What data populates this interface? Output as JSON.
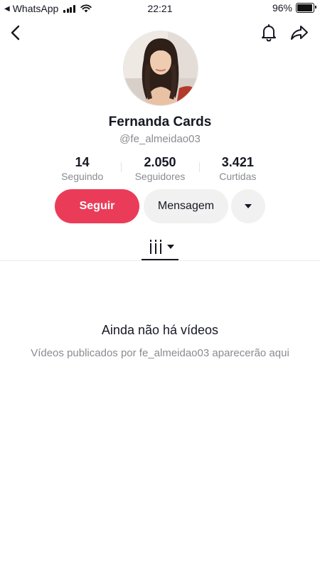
{
  "status_bar": {
    "back_app": "WhatsApp",
    "time": "22:21",
    "battery": "96%",
    "battery_level": 0.96
  },
  "header": {
    "back_icon": "chevron-left-icon",
    "bell_icon": "bell-icon",
    "share_icon": "share-arrow-icon"
  },
  "profile": {
    "name": "Fernanda Cards",
    "handle": "@fe_almeidao03",
    "avatar": "profile-photo"
  },
  "stats": [
    {
      "value": "14",
      "label": "Seguindo"
    },
    {
      "value": "2.050",
      "label": "Seguidores"
    },
    {
      "value": "3.421",
      "label": "Curtidas"
    }
  ],
  "actions": {
    "follow": "Seguir",
    "message": "Mensagem",
    "more_icon": "caret-down-icon"
  },
  "colors": {
    "accent": "#ea3c59",
    "secondary_button": "#f1f1f2",
    "muted_text": "#8a8b91"
  },
  "empty_state": {
    "title": "Ainda não há vídeos",
    "subtitle": "Vídeos publicados por fe_almeidao03 aparecerão aqui"
  }
}
